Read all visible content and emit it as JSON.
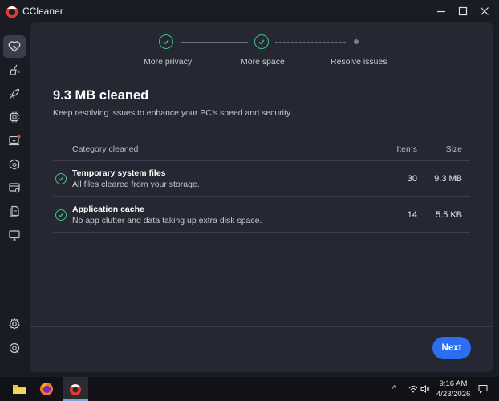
{
  "window": {
    "title": "CCleaner"
  },
  "colors": {
    "accent": "#2b6ef0",
    "success": "#3dc07a",
    "panel": "#252833",
    "background": "#1a1c24"
  },
  "sidebar": {
    "items": [
      {
        "icon": "health-check-heart-icon",
        "active": true
      },
      {
        "icon": "custom-clean-broom-icon",
        "active": false
      },
      {
        "icon": "performance-rocket-icon",
        "active": false
      },
      {
        "icon": "driver-chip-icon",
        "active": false
      },
      {
        "icon": "software-updater-icon",
        "active": false,
        "badge": true
      },
      {
        "icon": "privacy-eye-icon",
        "active": false
      },
      {
        "icon": "registry-icon",
        "active": false
      },
      {
        "icon": "files-icon",
        "active": false
      },
      {
        "icon": "monitor-icon",
        "active": false
      }
    ],
    "bottom": [
      {
        "icon": "gear-icon"
      },
      {
        "icon": "help-icon"
      }
    ]
  },
  "steps": [
    {
      "label": "More privacy",
      "state": "done"
    },
    {
      "label": "More space",
      "state": "done"
    },
    {
      "label": "Resolve issues",
      "state": "pending"
    }
  ],
  "result": {
    "title": "9.3 MB cleaned",
    "subtitle": "Keep resolving issues to enhance your PC's speed and security."
  },
  "table": {
    "headers": {
      "category": "Category cleaned",
      "items": "Items",
      "size": "Size"
    },
    "rows": [
      {
        "title": "Temporary system files",
        "description": "All files cleared from your storage.",
        "items": "30",
        "size": "9.3 MB"
      },
      {
        "title": "Application cache",
        "description": "No app clutter and data taking up extra disk space.",
        "items": "14",
        "size": "5.5 KB"
      }
    ]
  },
  "next_button": "Next",
  "taskbar": {
    "time": "9:16 AM",
    "date": "4/23/2026",
    "apps": [
      "file-explorer-icon",
      "firefox-icon",
      "ccleaner-icon"
    ]
  }
}
